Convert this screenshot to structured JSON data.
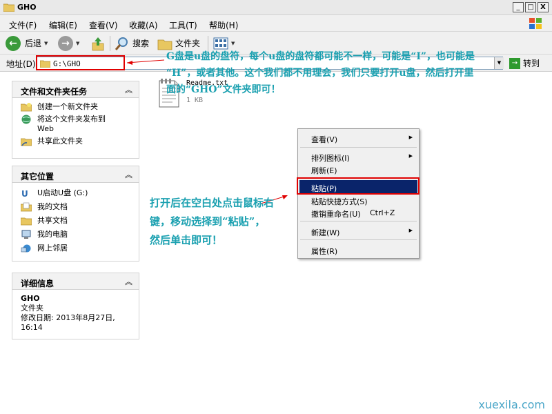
{
  "window": {
    "title": "GHO",
    "minimize": "_",
    "maximize": "□",
    "close": "X"
  },
  "menu": [
    {
      "label": "文件(F)"
    },
    {
      "label": "编辑(E)"
    },
    {
      "label": "查看(V)"
    },
    {
      "label": "收藏(A)"
    },
    {
      "label": "工具(T)"
    },
    {
      "label": "帮助(H)"
    }
  ],
  "toolbar": {
    "back": "后退",
    "search": "搜索",
    "folders": "文件夹"
  },
  "address": {
    "label": "地址(D)",
    "value": "G:\\GHO",
    "go": "转到"
  },
  "panels": {
    "tasks": {
      "title": "文件和文件夹任务",
      "items": [
        "创建一个新文件夹",
        "将这个文件夹发布到\nWeb",
        "共享此文件夹"
      ]
    },
    "places": {
      "title": "其它位置",
      "items": [
        "U启动U盘 (G:)",
        "我的文档",
        "共享文档",
        "我的电脑",
        "网上邻居"
      ]
    },
    "details": {
      "title": "详细信息",
      "name": "GHO",
      "type": "文件夹",
      "modified": "修改日期: 2013年8月27日,\n16:14"
    }
  },
  "file": {
    "name": "Readme.txt",
    "size": "1 KB"
  },
  "annotations": {
    "top": "G盘是u盘的盘符，每个u盘的盘符都可能不一样，可能是“I”，也可能是\n“H”，或者其他。这个我们都不用理会，我们只要打开u盘，然后打开里\n面的“GHO”文件夹即可！",
    "middle": "打开后在空白处点击鼠标右\n键，移动选择到“粘贴”，\n然后单击即可！"
  },
  "context_menu": {
    "view": "查看(V)",
    "arrange": "排列图标(I)",
    "refresh": "刷新(E)",
    "paste": "粘贴(P)",
    "paste_shortcut": "粘贴快捷方式(S)",
    "undo_rename": "撤销重命名(U)",
    "undo_shortcut": "Ctrl+Z",
    "new": "新建(W)",
    "properties": "属性(R)"
  },
  "watermark": "xuexila.com",
  "colors": {
    "annotation": "#1aa0b0",
    "highlight": "#e00000",
    "selection": "#0a246a"
  }
}
